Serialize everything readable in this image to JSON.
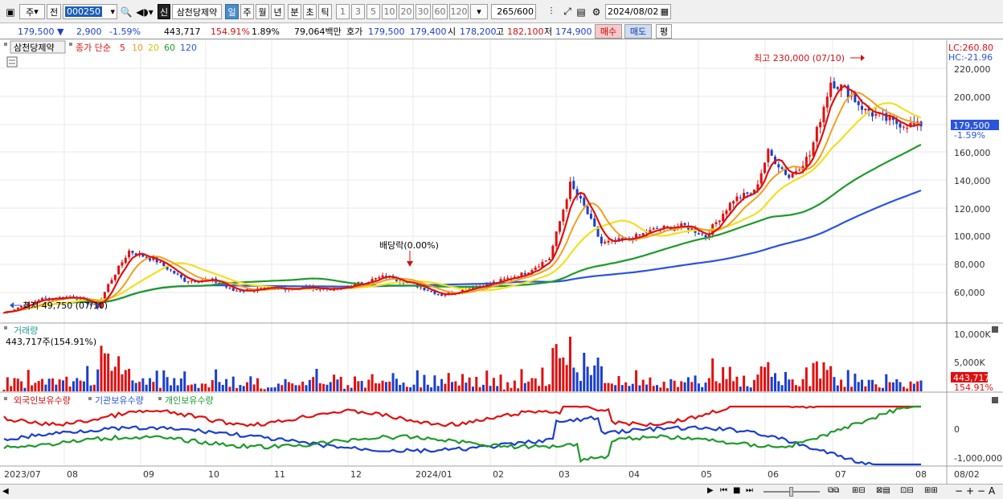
{
  "toolbar": {
    "market": "주",
    "range": "전",
    "code": "000250",
    "badge": "신",
    "stock_name": "삼천당제약",
    "periods": [
      "일",
      "주",
      "월",
      "년",
      "분",
      "초",
      "틱"
    ],
    "active_period": "일",
    "intervals": [
      "1",
      "3",
      "5",
      "10",
      "20",
      "30",
      "60",
      "120"
    ],
    "count": "265",
    "count_total": "/600",
    "date": "2024/08/02"
  },
  "quote": {
    "price": "179,500",
    "change": "2,900",
    "change_pct": "-1.59%",
    "volume": "443,717",
    "volume_ratio": "154.91%",
    "turnover_pct": "1.89%",
    "amount": "79,064백만",
    "hoga_label": "호가",
    "hoga_ask": "179,500",
    "hoga_bid": "179,400",
    "open_label": "시",
    "open": "178,200",
    "high_label": "고",
    "high": "182,100",
    "low_label": "저",
    "low": "174,900",
    "buy": "매수",
    "sell": "매도",
    "avg": "평"
  },
  "price_panel": {
    "stock_label": "삼천당제약",
    "ma_label": "종가 단순",
    "ma_periods": [
      "5",
      "10",
      "20",
      "60",
      "120"
    ],
    "lc_label": "LC:260.80",
    "hc_label": "HC:-21.96",
    "max_label": "최고 230,000 (07/10)",
    "min_label": "최저 49,750 (07/10)",
    "dividend_label": "배당락(0.00%)",
    "y_ticks": [
      "220,000",
      "200,000",
      "180,000",
      "160,000",
      "140,000",
      "120,000",
      "100,000",
      "80,000",
      "60,000"
    ],
    "current_price": "179,500",
    "current_pct": "-1.59%"
  },
  "volume_panel": {
    "title": "거래량",
    "summary": "443,717주(154.91%)",
    "y_ticks": [
      "10,000K",
      "5,000K"
    ],
    "current": "443,717",
    "current_pct": "154.91%"
  },
  "holding_panel": {
    "foreign": "외국인보유수량",
    "institution": "기관보유수량",
    "individual": "개인보유수량",
    "y_ticks": [
      "0",
      "-1,000,000"
    ]
  },
  "x_axis": [
    "2023/07",
    "08",
    "09",
    "10",
    "11",
    "12",
    "2024/01",
    "02",
    "03",
    "04",
    "05",
    "06",
    "07",
    "08"
  ],
  "x_right": "08/02",
  "colors": {
    "up": "#e01010",
    "down": "#1a3fcc",
    "ma5": "#e01010",
    "ma10": "#f0a020",
    "ma20": "#f2e020",
    "ma60": "#1f9a2a",
    "ma120": "#2a55dd"
  },
  "chart_data": {
    "type": "candlestick",
    "xlabel": "",
    "ylabel": "",
    "ylim": [
      46000,
      238000
    ],
    "anchors": [
      {
        "i": 0,
        "close": 53000
      },
      {
        "i": 10,
        "close": 62000
      },
      {
        "i": 20,
        "close": 64000
      },
      {
        "i": 27,
        "close": 57000
      },
      {
        "i": 30,
        "close": 72000
      },
      {
        "i": 36,
        "close": 95000
      },
      {
        "i": 44,
        "close": 88000
      },
      {
        "i": 52,
        "close": 75000
      },
      {
        "i": 60,
        "close": 75000
      },
      {
        "i": 66,
        "close": 68000
      },
      {
        "i": 76,
        "close": 69000
      },
      {
        "i": 86,
        "close": 70000
      },
      {
        "i": 96,
        "close": 69000
      },
      {
        "i": 104,
        "close": 74000
      },
      {
        "i": 110,
        "close": 78000
      },
      {
        "i": 118,
        "close": 72000
      },
      {
        "i": 126,
        "close": 65000
      },
      {
        "i": 134,
        "close": 70000
      },
      {
        "i": 142,
        "close": 74000
      },
      {
        "i": 150,
        "close": 80000
      },
      {
        "i": 157,
        "close": 90000
      },
      {
        "i": 163,
        "close": 140000
      },
      {
        "i": 167,
        "close": 125000
      },
      {
        "i": 172,
        "close": 100000
      },
      {
        "i": 180,
        "close": 103000
      },
      {
        "i": 188,
        "close": 110000
      },
      {
        "i": 196,
        "close": 112000
      },
      {
        "i": 202,
        "close": 105000
      },
      {
        "i": 210,
        "close": 130000
      },
      {
        "i": 216,
        "close": 135000
      },
      {
        "i": 220,
        "close": 162000
      },
      {
        "i": 226,
        "close": 145000
      },
      {
        "i": 232,
        "close": 160000
      },
      {
        "i": 238,
        "close": 210000
      },
      {
        "i": 242,
        "close": 205000
      },
      {
        "i": 248,
        "close": 190000
      },
      {
        "i": 256,
        "close": 182000
      },
      {
        "i": 264,
        "close": 179500
      }
    ]
  }
}
